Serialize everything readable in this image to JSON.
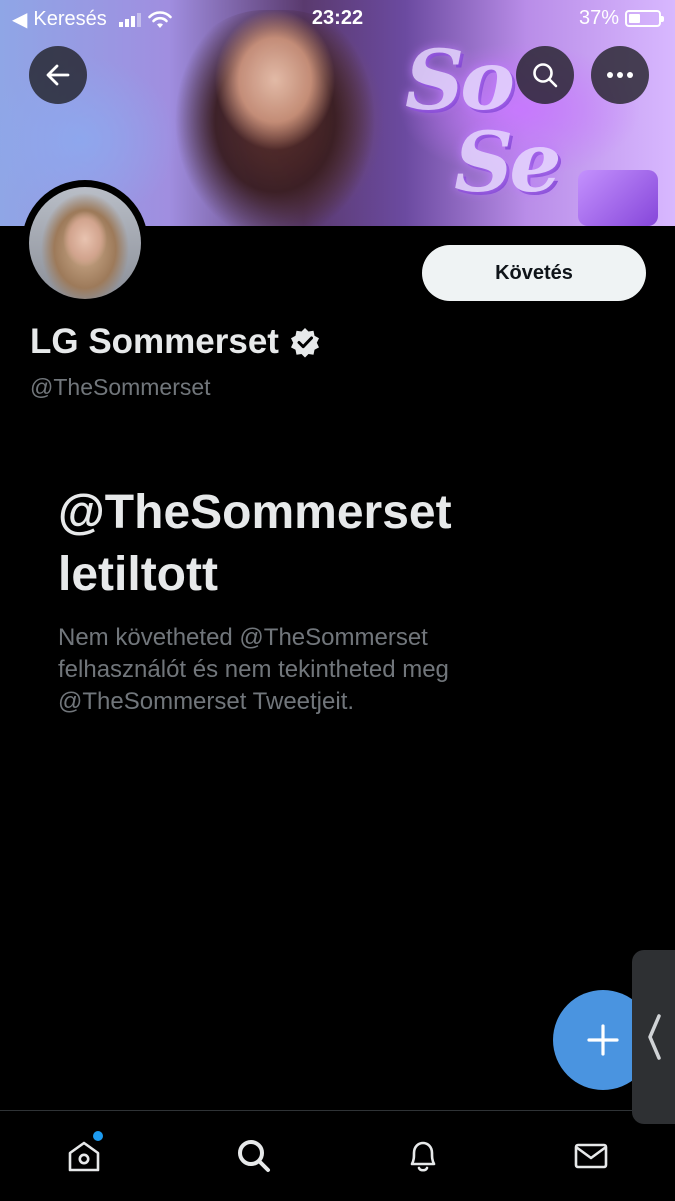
{
  "status_bar": {
    "carrier": "Keresés",
    "time": "23:22",
    "battery": "37%"
  },
  "profile": {
    "display_name": "LG Sommerset",
    "handle": "@TheSommerset",
    "verified": true,
    "follow_label": "Követés"
  },
  "blocked": {
    "title": "@TheSommerset letiltott",
    "description": "Nem követheted @TheSommerset felhasználót és nem tekintheted meg @TheSommerset Tweetjeit."
  },
  "icons": {
    "back": "arrow-left-icon",
    "search": "search-icon",
    "more": "more-icon",
    "verified": "verified-badge-icon",
    "compose": "plus-icon",
    "home": "home-icon",
    "explore": "search-icon",
    "notifications": "bell-icon",
    "messages": "mail-icon"
  },
  "colors": {
    "accent": "#1d9bf0",
    "fab": "#4a94e0",
    "muted_text": "#71767b"
  }
}
